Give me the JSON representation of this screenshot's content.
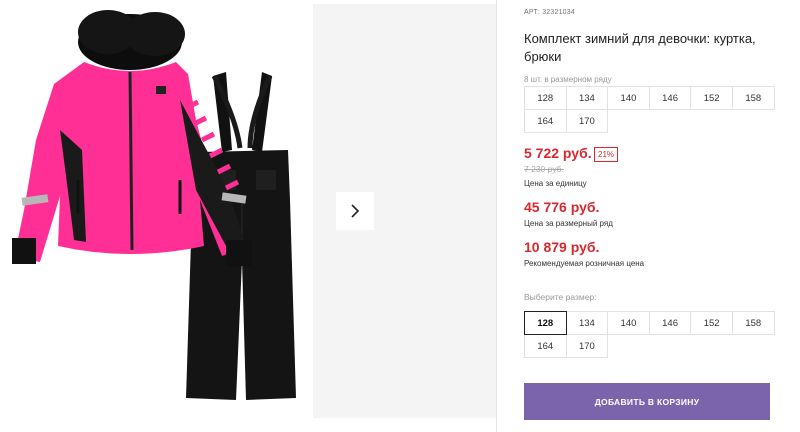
{
  "product": {
    "article_label": "АРТ:",
    "article": "32321034",
    "title": "Комплект зимний для девочки: куртка, брюки"
  },
  "size_series": {
    "note": "8 шт. в размерном ряду",
    "sizes": [
      "128",
      "134",
      "140",
      "146",
      "152",
      "158",
      "164",
      "170"
    ]
  },
  "pricing": {
    "unit_price": "5 722 руб.",
    "discount": "21%",
    "old_price": "7 230 руб.",
    "unit_caption": "Цена за единицу",
    "series_price": "45 776 руб.",
    "series_caption": "Цена за размерный ряд",
    "retail_price": "10 879 руб.",
    "retail_caption": "Рекомендуемая розничная цена"
  },
  "size_select": {
    "label": "Выберите размер:",
    "selected": "128",
    "sizes": [
      "128",
      "134",
      "140",
      "146",
      "152",
      "158",
      "164",
      "170"
    ]
  },
  "cart": {
    "button_label": "ДОБАВИТЬ В КОРЗИНУ"
  },
  "gallery": {
    "next_icon": "chevron-right-icon"
  },
  "colors": {
    "accent": "#7c64ad",
    "price": "#d72830",
    "jacket": "#ff2f95"
  }
}
